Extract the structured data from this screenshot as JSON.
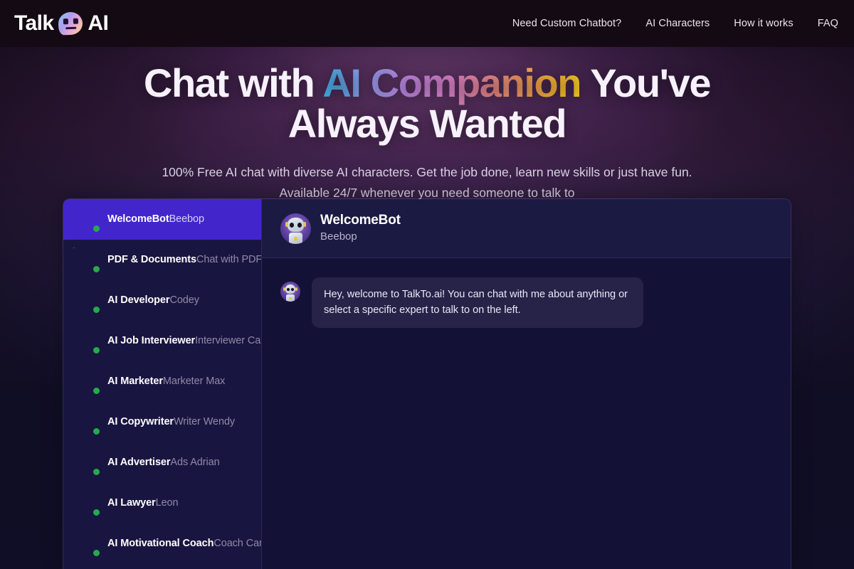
{
  "header": {
    "logo": {
      "word1": "Talk",
      "word2": "AI",
      "icon": "speech-bubble-robot-icon"
    },
    "nav": [
      {
        "label": "Need Custom Chatbot?"
      },
      {
        "label": "AI Characters"
      },
      {
        "label": "How it works"
      },
      {
        "label": "FAQ"
      }
    ]
  },
  "hero": {
    "title_part1": "Chat with ",
    "title_gradient": "AI Companion",
    "title_part2": " You've Always Wanted",
    "subtitle": "100% Free AI chat with diverse AI characters. Get the job done, learn new skills or just have fun. Available 24/7 whenever you need someone to talk to",
    "gradient_colors": [
      "#3fb8f0",
      "#c38ae8",
      "#e487cf",
      "#f79b63",
      "#ffd024"
    ]
  },
  "app": {
    "selected_accent": "#4226cc",
    "sidebar_bg": "#181640",
    "chat_bg": "#131236",
    "online_color": "#24ab4c",
    "characters": [
      {
        "name": "WelcomeBot",
        "persona": "Beebop",
        "avatar": "robot-avatar",
        "online": true,
        "selected": true
      },
      {
        "name": "PDF & Documents",
        "persona": "Chat with PDF",
        "avatar": "document-avatar",
        "online": true,
        "selected": false
      },
      {
        "name": "AI Developer",
        "persona": "Codey",
        "avatar": "cyborg-avatar",
        "online": true,
        "selected": false
      },
      {
        "name": "AI Job Interviewer",
        "persona": "Interviewer Cara",
        "avatar": "woman-interviewer-avatar",
        "online": true,
        "selected": false
      },
      {
        "name": "AI Marketer",
        "persona": "Marketer Max",
        "avatar": "man-marketer-avatar",
        "online": true,
        "selected": false
      },
      {
        "name": "AI Copywriter",
        "persona": "Writer Wendy",
        "avatar": "writer-avatar",
        "online": true,
        "selected": false
      },
      {
        "name": "AI Advertiser",
        "persona": "Ads Adrian",
        "avatar": "man-advertiser-avatar",
        "online": true,
        "selected": false
      },
      {
        "name": "AI Lawyer",
        "persona": "Leon",
        "avatar": "man-lawyer-avatar",
        "online": true,
        "selected": false
      },
      {
        "name": "AI Motivational Coach",
        "persona": "Coach Carl",
        "avatar": "man-coach-avatar",
        "online": true,
        "selected": false
      }
    ],
    "chat_header": {
      "name": "WelcomeBot",
      "persona": "Beebop",
      "avatar": "robot-avatar"
    },
    "messages": [
      {
        "sender": "WelcomeBot",
        "avatar": "robot-avatar",
        "text": "Hey, welcome to TalkTo.ai! You can chat with me about anything or select a specific expert to talk to on the left."
      }
    ]
  }
}
